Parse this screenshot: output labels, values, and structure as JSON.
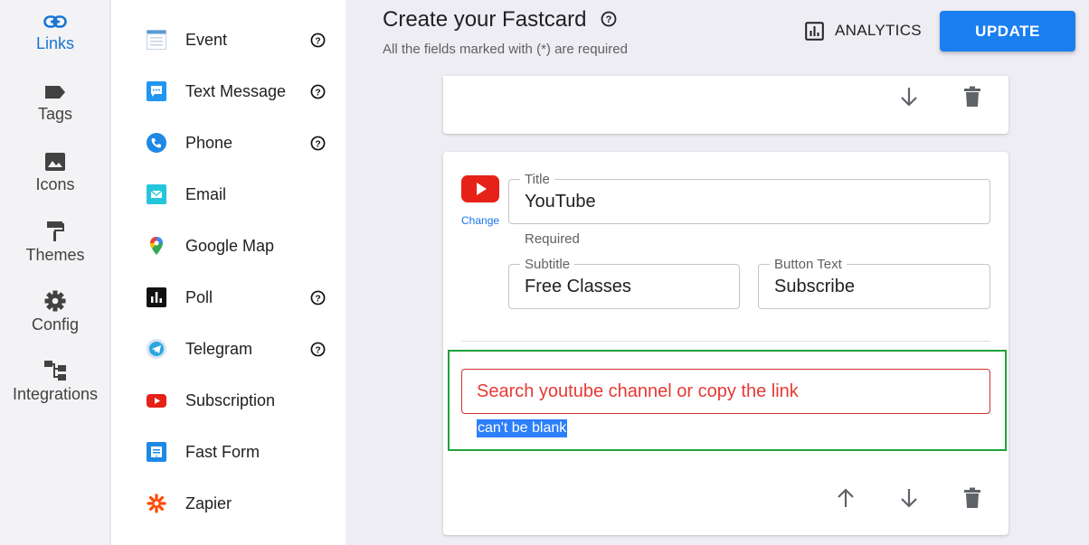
{
  "rail": {
    "items": [
      {
        "label": "Links",
        "icon": "link-icon",
        "active": true
      },
      {
        "label": "Tags",
        "icon": "tag-icon"
      },
      {
        "label": "Icons",
        "icon": "image-icon"
      },
      {
        "label": "Themes",
        "icon": "paint-roller-icon"
      },
      {
        "label": "Config",
        "icon": "gear-icon"
      },
      {
        "label": "Integrations",
        "icon": "integrations-icon"
      }
    ]
  },
  "palette": {
    "items": [
      {
        "label": "Event",
        "icon": "calendar-icon",
        "help": true
      },
      {
        "label": "Text Message",
        "icon": "chat-bubble-icon",
        "help": true
      },
      {
        "label": "Phone",
        "icon": "phone-icon",
        "help": true
      },
      {
        "label": "Email",
        "icon": "email-icon",
        "help": false
      },
      {
        "label": "Google Map",
        "icon": "map-pin-icon",
        "help": false
      },
      {
        "label": "Poll",
        "icon": "poll-icon",
        "help": true
      },
      {
        "label": "Telegram",
        "icon": "telegram-icon",
        "help": true
      },
      {
        "label": "Subscription",
        "icon": "youtube-icon",
        "help": false
      },
      {
        "label": "Fast Form",
        "icon": "form-icon",
        "help": false
      },
      {
        "label": "Zapier",
        "icon": "zapier-icon",
        "help": false
      }
    ]
  },
  "header": {
    "title": "Create your Fastcard",
    "subtitle": "All the fields marked with (*) are required",
    "analytics_label": "ANALYTICS",
    "update_label": "UPDATE"
  },
  "card": {
    "change_label": "Change",
    "title_label": "Title",
    "title_value": "YouTube",
    "required_hint": "Required",
    "subtitle_label": "Subtitle",
    "subtitle_value": "Free Classes",
    "button_text_label": "Button Text",
    "button_text_value": "Subscribe",
    "search_placeholder": "Search youtube channel or copy the link",
    "error_text": "can't be blank"
  },
  "colors": {
    "accent": "#1a7ff0",
    "rail_active": "#1976d2",
    "error": "#d32f2f",
    "highlight": "#1ea33b"
  }
}
